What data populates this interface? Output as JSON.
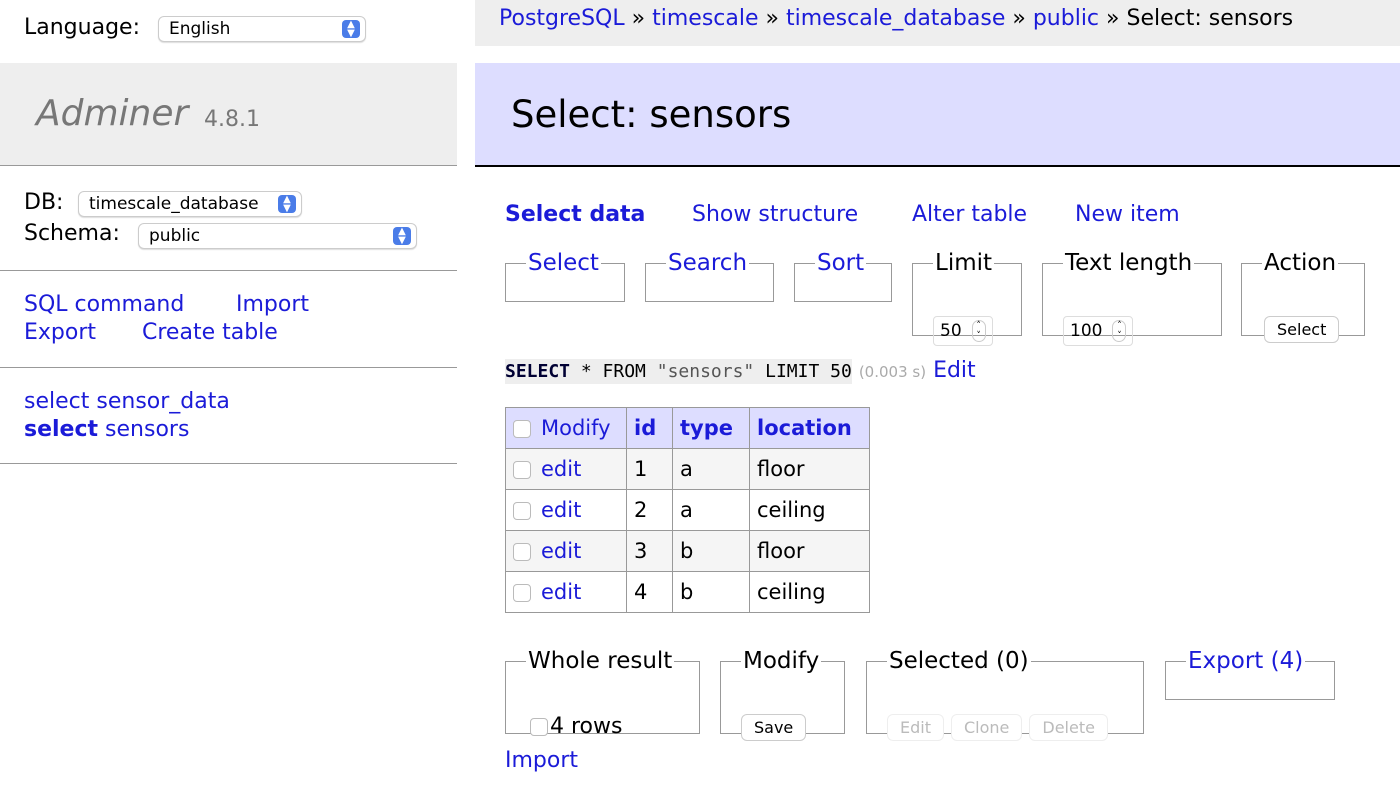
{
  "language": {
    "label": "Language:",
    "value": "English"
  },
  "logo": {
    "name": "Adminer",
    "version": "4.8.1"
  },
  "db": {
    "label": "DB:",
    "value": "timescale_database"
  },
  "schema": {
    "label": "Schema:",
    "value": "public"
  },
  "side_links": [
    "SQL command",
    "Import",
    "Export",
    "Create table"
  ],
  "tables": [
    {
      "prefix": "select",
      "name": "sensor_data"
    },
    {
      "prefix": "select",
      "name": "sensors"
    }
  ],
  "breadcrumb": [
    "PostgreSQL",
    "timescale",
    "timescale_database",
    "public"
  ],
  "breadcrumb_current": "Select: sensors",
  "sep": "»",
  "title": "Select: sensors",
  "tabs": [
    "Select data",
    "Show structure",
    "Alter table",
    "New item"
  ],
  "fieldsets": {
    "select": "Select",
    "search": "Search",
    "sort": "Sort",
    "limit": "Limit",
    "limit_value": "50",
    "text_length": "Text length",
    "text_length_value": "100",
    "action": "Action",
    "action_button": "Select"
  },
  "query": {
    "kw1": "SELECT",
    "rest": " * FROM ",
    "str": "\"sensors\"",
    "kw2": " LIMIT ",
    "num": "50",
    "time": "(0.003 s)",
    "edit": "Edit"
  },
  "table": {
    "headers": [
      "Modify",
      "id",
      "type",
      "location"
    ],
    "rows": [
      {
        "action": "edit",
        "id": "1",
        "type": "a",
        "location": "floor"
      },
      {
        "action": "edit",
        "id": "2",
        "type": "a",
        "location": "ceiling"
      },
      {
        "action": "edit",
        "id": "3",
        "type": "b",
        "location": "floor"
      },
      {
        "action": "edit",
        "id": "4",
        "type": "b",
        "location": "ceiling"
      }
    ]
  },
  "bottom": {
    "whole": "Whole result",
    "rows": "4 rows",
    "modify": "Modify",
    "save": "Save",
    "selected": "Selected (0)",
    "edit": "Edit",
    "clone": "Clone",
    "delete": "Delete",
    "export": "Export (4)",
    "import": "Import"
  }
}
